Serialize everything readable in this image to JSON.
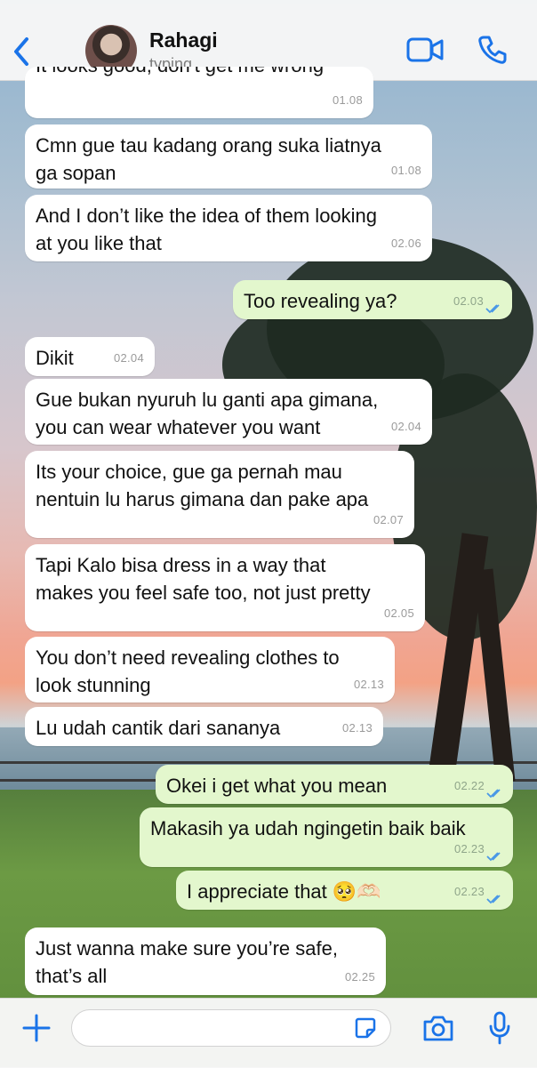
{
  "header": {
    "contact_name": "Rahagi",
    "status": "typing...",
    "accent_color": "#1a73e8",
    "icons": [
      "back-chevron-icon",
      "video-call-icon",
      "phone-icon"
    ]
  },
  "messages": [
    {
      "dir": "in",
      "lines": [
        "It looks good, don’t get me wrong"
      ],
      "time": "01.08"
    },
    {
      "dir": "in",
      "lines": [
        "Cmn gue tau kadang orang suka liatnya",
        "ga sopan"
      ],
      "time": "01.08"
    },
    {
      "dir": "in",
      "lines": [
        "And I don’t like the idea of them looking",
        "at you like that"
      ],
      "time": "02.06"
    },
    {
      "dir": "out",
      "lines": [
        "Too revealing ya?"
      ],
      "time": "02.03",
      "read": true
    },
    {
      "dir": "in",
      "lines": [
        "Dikit"
      ],
      "time": "02.04"
    },
    {
      "dir": "in",
      "lines": [
        "Gue bukan nyuruh lu ganti apa gimana,",
        "you can wear whatever you want"
      ],
      "time": "02.04"
    },
    {
      "dir": "in",
      "lines": [
        "Its your choice, gue ga pernah mau",
        "nentuin lu harus gimana dan pake apa"
      ],
      "time": "02.07"
    },
    {
      "dir": "in",
      "lines": [
        "Tapi Kalo bisa dress in a way that",
        "makes you feel safe too, not just pretty"
      ],
      "time": "02.05"
    },
    {
      "dir": "in",
      "lines": [
        "You don’t need revealing clothes to",
        "look stunning"
      ],
      "time": "02.13"
    },
    {
      "dir": "in",
      "lines": [
        "Lu udah cantik dari sananya"
      ],
      "time": "02.13"
    },
    {
      "dir": "out",
      "lines": [
        "Okei i get what you mean"
      ],
      "time": "02.22",
      "read": true
    },
    {
      "dir": "out",
      "lines": [
        "Makasih ya udah ngingetin baik baik"
      ],
      "time": "02.23",
      "read": true
    },
    {
      "dir": "out",
      "lines": [
        "I appreciate that 🥺🫶🏻"
      ],
      "time": "02.23",
      "read": true
    },
    {
      "dir": "in",
      "lines": [
        "Just wanna make sure you’re safe,",
        "that’s all"
      ],
      "time": "02.25"
    }
  ],
  "footer": {
    "input_value": "",
    "icons": [
      "plus-icon",
      "sticker-icon",
      "camera-icon",
      "microphone-icon"
    ]
  }
}
